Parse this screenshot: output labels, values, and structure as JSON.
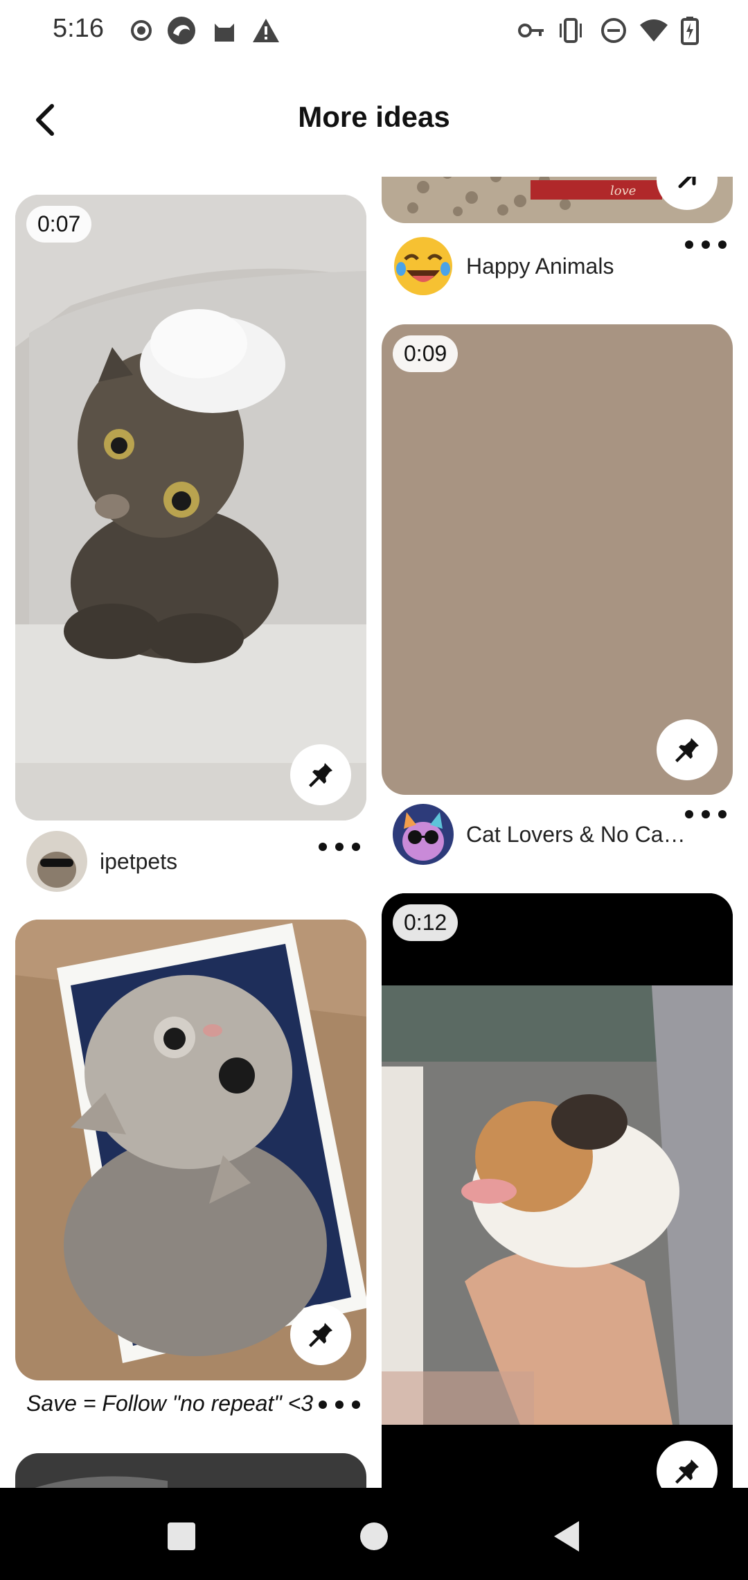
{
  "status_bar": {
    "time": "5:16",
    "left_icons": [
      "record-icon",
      "browser-icon",
      "cat-app-icon",
      "warning-icon"
    ],
    "right_icons": [
      "vpn-key-icon",
      "vibrate-icon",
      "do-not-disturb-icon",
      "wifi-icon",
      "battery-charging-icon"
    ]
  },
  "header": {
    "title": "More ideas",
    "back_icon": "back-arrow-icon"
  },
  "feed": {
    "left_column": [
      {
        "duration": "0:07",
        "creator": "ipetpets",
        "image": "kitten in bathtub with foam on head"
      },
      {
        "caption": "Save = Follow \"no repeat\" <3",
        "image": "grey cat in box looking up"
      }
    ],
    "right_column": [
      {
        "creator": "Happy Animals",
        "image": "cat on textured surface (partially visible)"
      },
      {
        "duration": "0:09",
        "creator": "Cat Lovers & No Ca…",
        "image": "placeholder brown"
      },
      {
        "duration": "0:12",
        "image": "kitten held in hand"
      }
    ]
  },
  "colors": {
    "accent_placeholder": "#a89482",
    "nav_bar": "#000000"
  },
  "nav_bar": {
    "buttons": [
      "recents-square-icon",
      "home-circle-icon",
      "back-triangle-icon"
    ]
  }
}
